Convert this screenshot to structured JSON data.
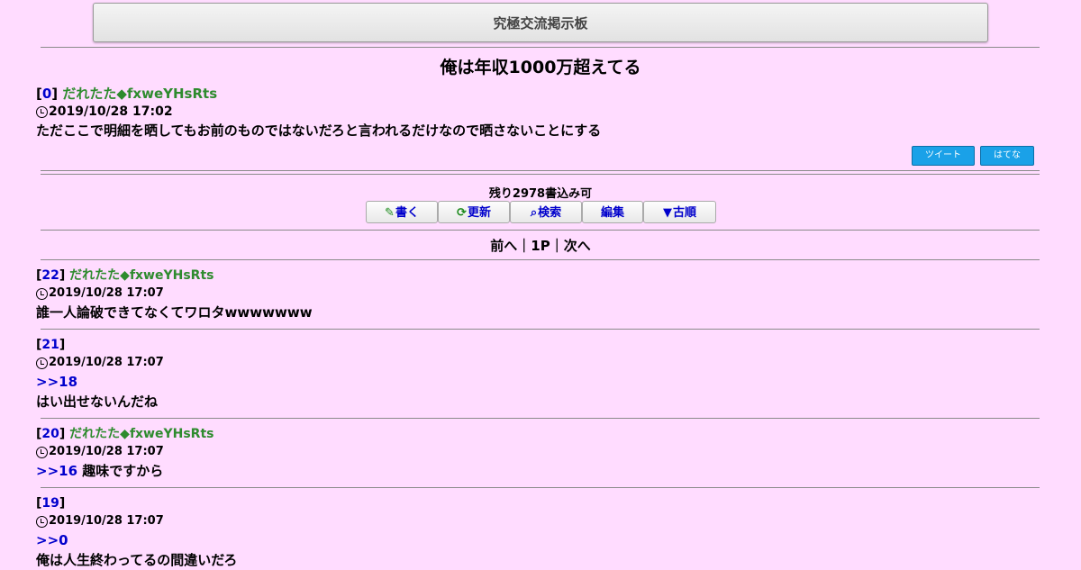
{
  "board": {
    "title": "究極交流掲示板"
  },
  "thread": {
    "title": "俺は年収1000万超えてる",
    "op": {
      "no": "0",
      "name": "だれたた◆fxweYHsRts",
      "date": "2019/10/28 17:02",
      "body": "ただここで明細を晒してもお前のものではないだろと言われるだけなので晒さないことにする"
    }
  },
  "share": {
    "tweet": "ツイート",
    "hatena": "はてな"
  },
  "remaining": "残り2978書込み可",
  "toolbar": {
    "write": "書く",
    "refresh": "更新",
    "search": "検索",
    "edit": "編集",
    "old_order": "古順"
  },
  "pager": {
    "prev": "前へ",
    "sep": "｜",
    "page": "1P",
    "next": "次へ"
  },
  "posts": [
    {
      "no": "22",
      "name": "だれたた◆fxweYHsRts",
      "date": "2019/10/28 17:07",
      "anchor": "",
      "body": "誰一人論破できてなくてワロタwwwwwww"
    },
    {
      "no": "21",
      "name": "",
      "date": "2019/10/28 17:07",
      "anchor": ">>18",
      "body": "はい出せないんだね"
    },
    {
      "no": "20",
      "name": "だれたた◆fxweYHsRts",
      "date": "2019/10/28 17:07",
      "anchor": ">>16",
      "body": "趣味ですから"
    },
    {
      "no": "19",
      "name": "",
      "date": "2019/10/28 17:07",
      "anchor": ">>0",
      "body": "俺は人生終わってるの間違いだろ"
    }
  ],
  "colors": {
    "background": "#ffdcff",
    "link": "#0000cc",
    "name": "#2e8b2e",
    "share_button": "#1aa1e8"
  }
}
